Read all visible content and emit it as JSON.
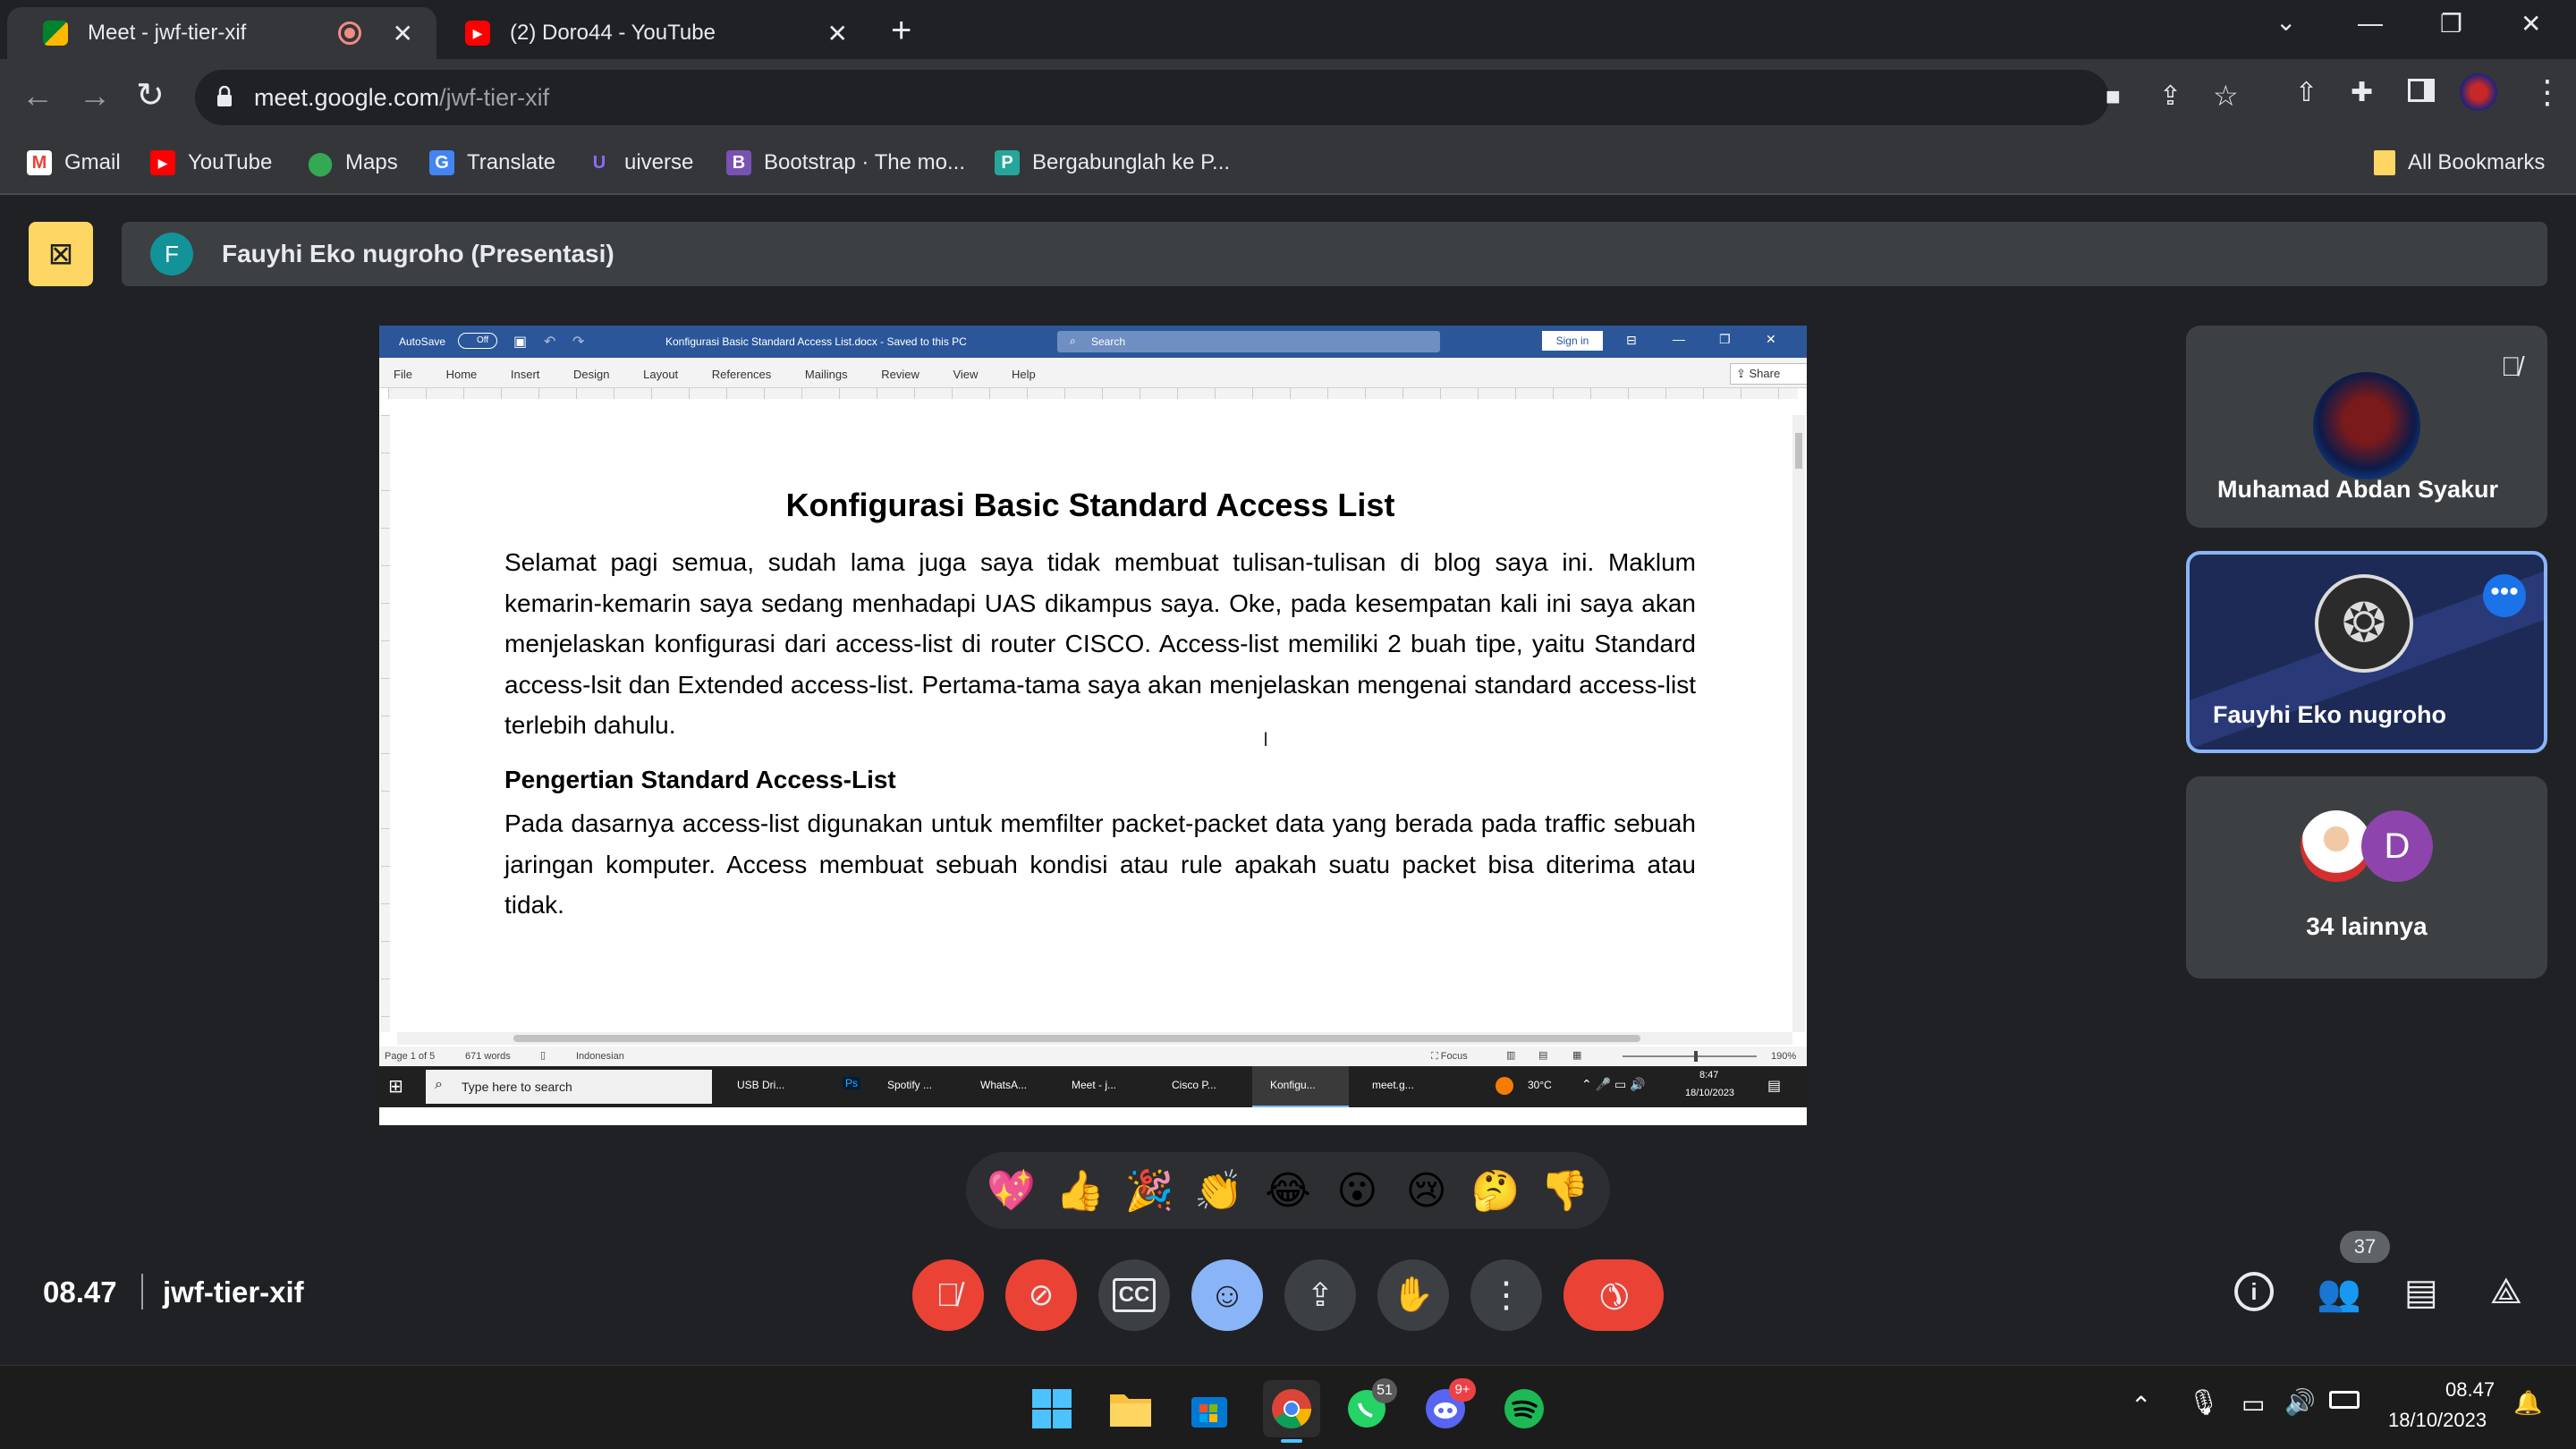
{
  "browser": {
    "tabs": [
      {
        "title": "Meet - jwf-tier-xif",
        "active": true
      },
      {
        "title": "(2) Doro44 - YouTube",
        "active": false
      }
    ],
    "url_host": "meet.google.com",
    "url_path": "/jwf-tier-xif",
    "bookmarks": [
      "Gmail",
      "YouTube",
      "Maps",
      "Translate",
      "uiverse",
      "Bootstrap · The mo...",
      "Bergabunglah ke P..."
    ],
    "all_bookmarks": "All Bookmarks"
  },
  "meet": {
    "presenter_initial": "F",
    "presenter_label": "Fauyhi Eko nugroho (Presentasi)",
    "participants": [
      {
        "name": "Muhamad Abdan Syakur",
        "muted": true
      },
      {
        "name": "Fauyhi Eko nugroho"
      },
      {
        "name": "34 lainnya",
        "initial": "D"
      }
    ],
    "reactions": [
      "💖",
      "👍",
      "🎉",
      "👏",
      "😂",
      "😮",
      "😢",
      "🤔",
      "👎"
    ],
    "time": "08.47",
    "meeting_code": "jwf-tier-xif",
    "people_count": "37"
  },
  "shared_screen": {
    "autosave": "AutoSave",
    "autosave_state": "Off",
    "doc_title": "Konfigurasi Basic Standard Access List.docx  -  Saved to this PC",
    "search": "Search",
    "sign_in": "Sign in",
    "ribbon_tabs": [
      "File",
      "Home",
      "Insert",
      "Design",
      "Layout",
      "References",
      "Mailings",
      "Review",
      "View",
      "Help"
    ],
    "share": "Share",
    "heading": "Konfigurasi Basic Standard Access List",
    "para1": "Selamat pagi semua, sudah lama juga saya tidak membuat tulisan-tulisan di blog saya ini. Maklum kemarin-kemarin saya sedang menhadapi UAS dikampus saya. Oke, pada kesempatan kali ini saya akan menjelaskan konfigurasi dari access-list di router CISCO. Access-list memiliki 2 buah tipe, yaitu Standard access-lsit dan Extended access-list. Pertama-tama saya akan menjelaskan mengenai standard access-list terlebih dahulu.",
    "subheading": "Pengertian Standard Access-List",
    "para2": "Pada dasarnya access-list digunakan untuk memfilter packet-packet data yang berada pada traffic sebuah jaringan komputer. Access membuat sebuah kondisi atau rule apakah suatu packet bisa diterima atau tidak.",
    "status_page": "Page 1 of 5",
    "status_words": "671 words",
    "status_lang": "Indonesian",
    "focus": "Focus",
    "zoom": "190%",
    "inner_taskbar": {
      "search": "Type here to search",
      "apps": [
        "USB Dri...",
        "Ps",
        "Spotify ...",
        "WhatsA...",
        "Meet - j...",
        "Cisco P...",
        "Konfigu...",
        "meet.g..."
      ],
      "temp": "30°C",
      "time": "8:47",
      "date": "18/10/2023"
    }
  },
  "taskbar": {
    "whatsapp_badge": "51",
    "discord_badge": "9+",
    "time": "08.47",
    "date": "18/10/2023"
  }
}
